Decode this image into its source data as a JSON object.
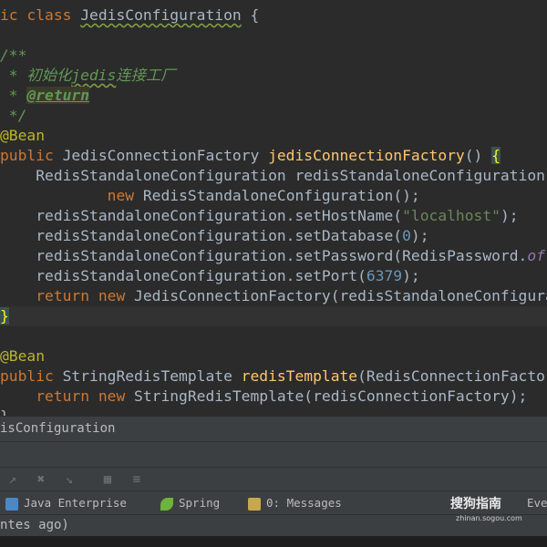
{
  "editor": {
    "lines": [
      {
        "segments": [
          {
            "t": "ic ",
            "c": "kw"
          },
          {
            "t": "class ",
            "c": "kw"
          },
          {
            "t": "JedisConfiguration",
            "c": "typo"
          },
          {
            "t": " {",
            "c": ""
          }
        ]
      },
      {
        "segments": []
      },
      {
        "segments": [
          {
            "t": "/**",
            "c": "cm"
          }
        ]
      },
      {
        "segments": [
          {
            "t": " * 初始化",
            "c": "cm"
          },
          {
            "t": "jedis",
            "c": "cm typo"
          },
          {
            "t": "连接工厂",
            "c": "cm"
          }
        ]
      },
      {
        "segments": [
          {
            "t": " * ",
            "c": "cm"
          },
          {
            "t": "@return",
            "c": "tag"
          }
        ]
      },
      {
        "segments": [
          {
            "t": " */",
            "c": "cm"
          }
        ]
      },
      {
        "segments": [
          {
            "t": "@Bean",
            "c": "ann"
          }
        ]
      },
      {
        "segments": [
          {
            "t": "public ",
            "c": "kw"
          },
          {
            "t": "JedisConnectionFactory ",
            "c": ""
          },
          {
            "t": "jedisConnectionFactory",
            "c": "fn"
          },
          {
            "t": "() ",
            "c": ""
          },
          {
            "t": "{",
            "c": "brace"
          }
        ]
      },
      {
        "segments": [
          {
            "t": "    RedisStandaloneConfiguration redisStandaloneConfiguration = ",
            "c": ""
          }
        ]
      },
      {
        "segments": [
          {
            "t": "            ",
            "c": ""
          },
          {
            "t": "new ",
            "c": "kw"
          },
          {
            "t": "RedisStandaloneConfiguration();",
            "c": ""
          }
        ]
      },
      {
        "segments": [
          {
            "t": "    redisStandaloneConfiguration.setHostName(",
            "c": ""
          },
          {
            "t": "\"localhost\"",
            "c": "str"
          },
          {
            "t": ");",
            "c": ""
          }
        ]
      },
      {
        "segments": [
          {
            "t": "    redisStandaloneConfiguration.setDatabase(",
            "c": ""
          },
          {
            "t": "0",
            "c": "num"
          },
          {
            "t": ");",
            "c": ""
          }
        ]
      },
      {
        "segments": [
          {
            "t": "    redisStandaloneConfiguration.setPassword(RedisPassword.",
            "c": ""
          },
          {
            "t": "of",
            "c": "it"
          },
          {
            "t": "(",
            "c": ""
          }
        ]
      },
      {
        "segments": [
          {
            "t": "    redisStandaloneConfiguration.setPort(",
            "c": ""
          },
          {
            "t": "6379",
            "c": "num"
          },
          {
            "t": ");",
            "c": ""
          }
        ]
      },
      {
        "segments": [
          {
            "t": "    ",
            "c": ""
          },
          {
            "t": "return new ",
            "c": "kw"
          },
          {
            "t": "JedisConnectionFactory(redisStandaloneConfiguration);",
            "c": ""
          }
        ]
      },
      {
        "segments": [
          {
            "t": "}",
            "c": "brace"
          }
        ]
      },
      {
        "segments": []
      },
      {
        "segments": [
          {
            "t": "@Bean",
            "c": "ann"
          }
        ]
      },
      {
        "segments": [
          {
            "t": "public ",
            "c": "kw"
          },
          {
            "t": "StringRedisTemplate ",
            "c": ""
          },
          {
            "t": "redisTemplate",
            "c": "fn"
          },
          {
            "t": "(RedisConnectionFactory redisConnectionFactory) {",
            "c": ""
          }
        ]
      },
      {
        "segments": [
          {
            "t": "    ",
            "c": ""
          },
          {
            "t": "return new ",
            "c": "kw"
          },
          {
            "t": "StringRedisTemplate(redisConnectionFactory);",
            "c": ""
          }
        ]
      },
      {
        "segments": [
          {
            "t": "}",
            "c": ""
          }
        ]
      }
    ]
  },
  "breadcrumb": {
    "text": "isConfiguration"
  },
  "tool_tabs": [
    {
      "label": "Java Enterprise",
      "icon": "java-enterprise-icon",
      "color": "#4a88c7"
    },
    {
      "label": "Spring",
      "icon": "spring-leaf-icon",
      "color": "#6db33f"
    },
    {
      "label": "0: Messages",
      "icon": "messages-icon",
      "color": "#c9a84c"
    },
    {
      "label": "Eve",
      "icon": "event-log-icon",
      "color": "#bbbbbb"
    }
  ],
  "status": {
    "text": "ntes ago)"
  },
  "watermark": {
    "main": "搜狗指南",
    "sub": "zhinan.sogou.com"
  }
}
